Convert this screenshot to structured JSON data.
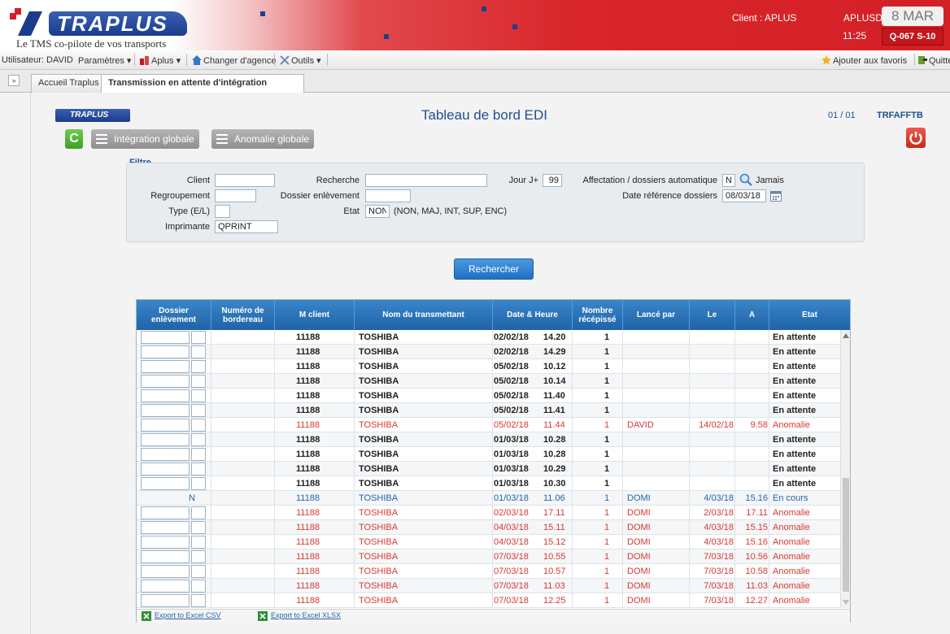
{
  "app": {
    "logo_text": "TRAPLUS",
    "tagline": "Le TMS co-pilote de vos transports",
    "client_label": "Client : APLUS",
    "user_code": "APLUSD",
    "time": "11:25",
    "date": "8 MAR",
    "week": "Q-067 S-10"
  },
  "menubar": {
    "user": "Utilisateur: DAVID",
    "parametres": "Paramètres ▾",
    "aplus": "Aplus ▾",
    "changer_agence": "Changer d'agence",
    "outils": "Outils ▾",
    "favoris": "Ajouter aux favoris",
    "quitter": "Quitte"
  },
  "tabs": {
    "collapse": "»",
    "home": "Accueil Traplus",
    "active": "Transmission en attente d'intégration"
  },
  "page": {
    "logo_text": "TRAPLUS",
    "title": "Tableau de bord EDI",
    "pagination": "01  /  01",
    "code": "TRFAFFTB",
    "btn_integration": "Intégration globale",
    "btn_anomalie": "Anomalie globale",
    "btn_refresh": "C",
    "btn_search": "Rechercher"
  },
  "filter": {
    "legend": "Filtre",
    "client_label": "Client",
    "client_value": "",
    "regroupement_label": "Regroupement",
    "regroupement_value": "",
    "type_label": "Type (E/L)",
    "type_value": "",
    "imprimante_label": "Imprimante",
    "imprimante_value": "QPRINT",
    "recherche_label": "Recherche",
    "recherche_value": "",
    "dossier_label": "Dossier enlèvement",
    "dossier_value": "",
    "etat_label": "Etat",
    "etat_value": "NON",
    "etat_hint": "(NON, MAJ, INT, SUP, ENC)",
    "jour_label": "Jour J+",
    "jour_value": "99",
    "affectation_label": "Affectation / dossiers automatique",
    "affectation_value": "N",
    "affectation_hint": "Jamais",
    "date_ref_label": "Date référence dossiers",
    "date_ref_value": "08/03/18"
  },
  "table": {
    "headers": [
      "Dossier enlèvement",
      "Numéro de bordereau",
      "M client",
      "Nom du transmettant",
      "Date & Heure",
      "Nombre récépissé",
      "Lancé par",
      "Le",
      "A",
      "Etat"
    ],
    "rows": [
      {
        "dossier": "",
        "mclient": "11188",
        "nom": "TOSHIBA",
        "date": "02/02/18",
        "heure": "14.20",
        "nombre": "1",
        "lance": "",
        "le": "",
        "a": "",
        "etat": "En attente",
        "kind": "wait"
      },
      {
        "dossier": "",
        "mclient": "11188",
        "nom": "TOSHIBA",
        "date": "02/02/18",
        "heure": "14.29",
        "nombre": "1",
        "lance": "",
        "le": "",
        "a": "",
        "etat": "En attente",
        "kind": "wait"
      },
      {
        "dossier": "",
        "mclient": "11188",
        "nom": "TOSHIBA",
        "date": "05/02/18",
        "heure": "10.12",
        "nombre": "1",
        "lance": "",
        "le": "",
        "a": "",
        "etat": "En attente",
        "kind": "wait"
      },
      {
        "dossier": "",
        "mclient": "11188",
        "nom": "TOSHIBA",
        "date": "05/02/18",
        "heure": "10.14",
        "nombre": "1",
        "lance": "",
        "le": "",
        "a": "",
        "etat": "En attente",
        "kind": "wait"
      },
      {
        "dossier": "",
        "mclient": "11188",
        "nom": "TOSHIBA",
        "date": "05/02/18",
        "heure": "11.40",
        "nombre": "1",
        "lance": "",
        "le": "",
        "a": "",
        "etat": "En attente",
        "kind": "wait"
      },
      {
        "dossier": "",
        "mclient": "11188",
        "nom": "TOSHIBA",
        "date": "05/02/18",
        "heure": "11.41",
        "nombre": "1",
        "lance": "",
        "le": "",
        "a": "",
        "etat": "En attente",
        "kind": "wait"
      },
      {
        "dossier": "",
        "mclient": "11188",
        "nom": "TOSHIBA",
        "date": "05/02/18",
        "heure": "11.44",
        "nombre": "1",
        "lance": "DAVID",
        "le": "14/02/18",
        "a": "9.58",
        "etat": "Anomalie",
        "kind": "anom"
      },
      {
        "dossier": "",
        "mclient": "11188",
        "nom": "TOSHIBA",
        "date": "01/03/18",
        "heure": "10.28",
        "nombre": "1",
        "lance": "",
        "le": "",
        "a": "",
        "etat": "En attente",
        "kind": "wait"
      },
      {
        "dossier": "",
        "mclient": "11188",
        "nom": "TOSHIBA",
        "date": "01/03/18",
        "heure": "10.28",
        "nombre": "1",
        "lance": "",
        "le": "",
        "a": "",
        "etat": "En attente",
        "kind": "wait"
      },
      {
        "dossier": "",
        "mclient": "11188",
        "nom": "TOSHIBA",
        "date": "01/03/18",
        "heure": "10.29",
        "nombre": "1",
        "lance": "",
        "le": "",
        "a": "",
        "etat": "En attente",
        "kind": "wait"
      },
      {
        "dossier": "",
        "mclient": "11188",
        "nom": "TOSHIBA",
        "date": "01/03/18",
        "heure": "10.30",
        "nombre": "1",
        "lance": "",
        "le": "",
        "a": "",
        "etat": "En attente",
        "kind": "wait"
      },
      {
        "dossier": "N",
        "mclient": "11188",
        "nom": "TOSHIBA",
        "date": "01/03/18",
        "heure": "11.06",
        "nombre": "1",
        "lance": "DOMI",
        "le": "4/03/18",
        "a": "15.16",
        "etat": "En cours",
        "kind": "enc"
      },
      {
        "dossier": "",
        "mclient": "11188",
        "nom": "TOSHIBA",
        "date": "02/03/18",
        "heure": "17.11",
        "nombre": "1",
        "lance": "DOMI",
        "le": "2/03/18",
        "a": "17.11",
        "etat": "Anomalie",
        "kind": "anom"
      },
      {
        "dossier": "",
        "mclient": "11188",
        "nom": "TOSHIBA",
        "date": "04/03/18",
        "heure": "15.11",
        "nombre": "1",
        "lance": "DOMI",
        "le": "4/03/18",
        "a": "15.15",
        "etat": "Anomalie",
        "kind": "anom"
      },
      {
        "dossier": "",
        "mclient": "11188",
        "nom": "TOSHIBA",
        "date": "04/03/18",
        "heure": "15.12",
        "nombre": "1",
        "lance": "DOMI",
        "le": "4/03/18",
        "a": "15.16",
        "etat": "Anomalie",
        "kind": "anom"
      },
      {
        "dossier": "",
        "mclient": "11188",
        "nom": "TOSHIBA",
        "date": "07/03/18",
        "heure": "10.55",
        "nombre": "1",
        "lance": "DOMI",
        "le": "7/03/18",
        "a": "10.56",
        "etat": "Anomalie",
        "kind": "anom"
      },
      {
        "dossier": "",
        "mclient": "11188",
        "nom": "TOSHIBA",
        "date": "07/03/18",
        "heure": "10.57",
        "nombre": "1",
        "lance": "DOMI",
        "le": "7/03/18",
        "a": "10.58",
        "etat": "Anomalie",
        "kind": "anom"
      },
      {
        "dossier": "",
        "mclient": "11188",
        "nom": "TOSHIBA",
        "date": "07/03/18",
        "heure": "11.03",
        "nombre": "1",
        "lance": "DOMI",
        "le": "7/03/18",
        "a": "11.03",
        "etat": "Anomalie",
        "kind": "anom"
      },
      {
        "dossier": "",
        "mclient": "11188",
        "nom": "TOSHIBA",
        "date": "07/03/18",
        "heure": "12.25",
        "nombre": "1",
        "lance": "DOMI",
        "le": "7/03/18",
        "a": "12.27",
        "etat": "Anomalie",
        "kind": "anom"
      }
    ],
    "export_csv": "Export to Excel CSV",
    "export_xlsx": "Export to Excel XLSX"
  },
  "colors": {
    "brand_red": "#d32026",
    "brand_blue": "#1f4f8f",
    "header_blue": "#2a74ba",
    "anomaly_red": "#d53a32",
    "in_progress_blue": "#2464a8"
  }
}
